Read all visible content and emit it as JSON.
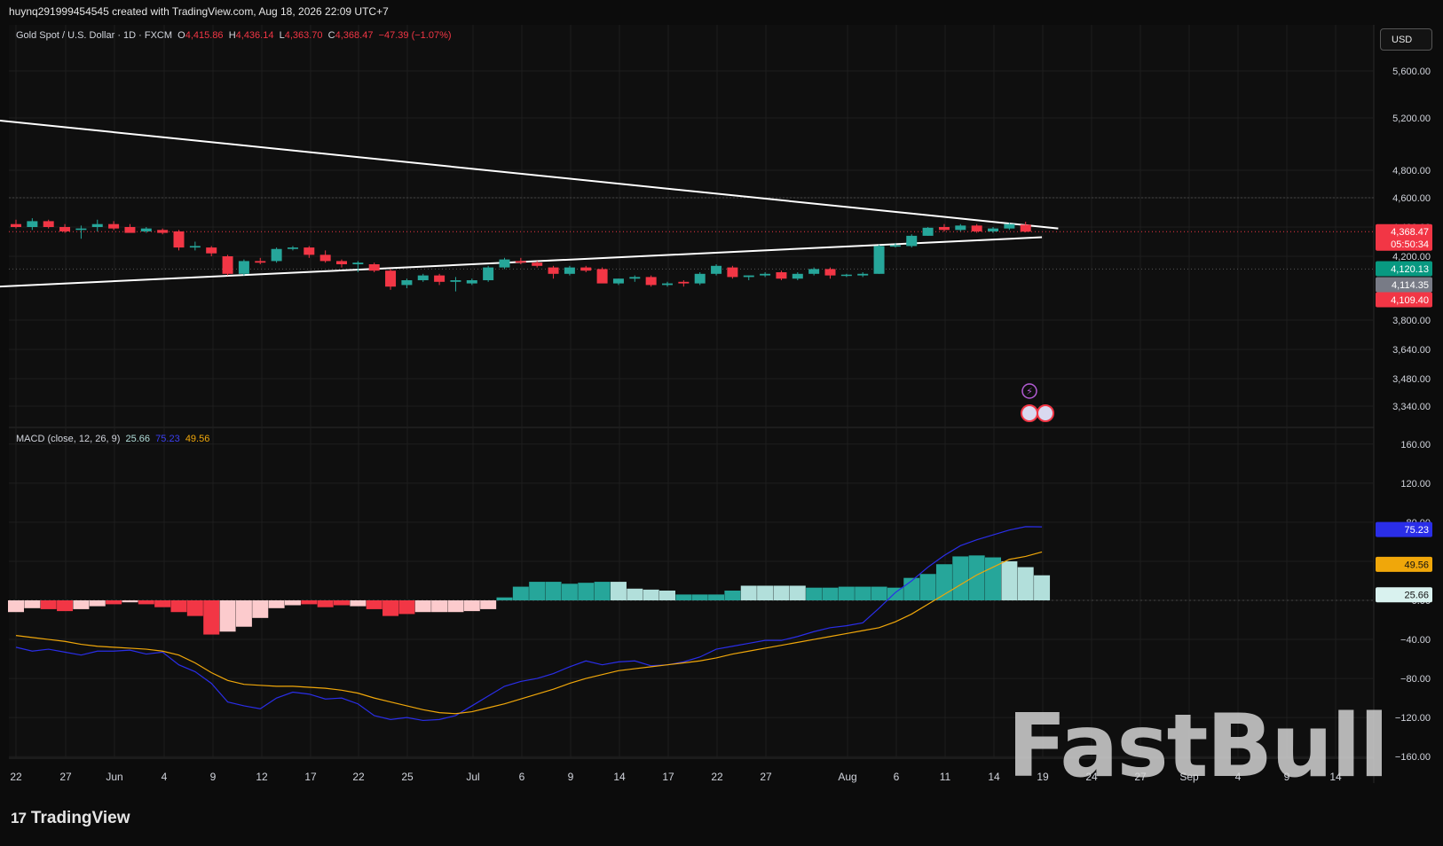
{
  "header": {
    "attribution": "huynq291999454545 created with TradingView.com, Aug 18, 2026 22:09 UTC+7"
  },
  "legend": {
    "symbol": "Gold Spot / U.S. Dollar · 1D · FXCM",
    "o_label": "O",
    "o": "4,415.86",
    "h_label": "H",
    "h": "4,436.14",
    "l_label": "L",
    "l": "4,363.70",
    "c_label": "C",
    "c": "4,368.47",
    "change": "−47.39 (−1.07%)"
  },
  "currency_button": "USD",
  "macd_legend": {
    "label": "MACD (close, 12, 26, 9)",
    "hist": "25.66",
    "macd": "75.23",
    "signal": "49.56"
  },
  "colors": {
    "up": "#26a69a",
    "down": "#f23645",
    "macd_line": "#2a2ee8",
    "signal_line": "#f0a70a",
    "hist_up_strong": "#26a69a",
    "hist_up_weak": "#b2dfdb",
    "hist_down_strong": "#f23645",
    "hist_down_weak": "#fccbcd"
  },
  "footer": {
    "logo_mark": "17",
    "logo_text": "TradingView"
  },
  "watermark": "FastBull",
  "price_labels": [
    {
      "text": "4,368.47",
      "sub": "05:50:34",
      "value": 4368.47,
      "color": "#f23645"
    },
    {
      "text": "4,120.13",
      "value": 4120.13,
      "color": "#089981"
    },
    {
      "text": "4,114.35",
      "value": 4114.35,
      "color": "#787b86"
    },
    {
      "text": "4,109.40",
      "value": 4109.4,
      "color": "#f23645"
    }
  ],
  "macd_labels": [
    {
      "text": "75.23",
      "value": 75.23,
      "color": "#2a2ee8"
    },
    {
      "text": "49.56",
      "value": 49.56,
      "color": "#f0a70a"
    },
    {
      "text": "25.66",
      "value": 25.66,
      "color": "#b2dfdb"
    }
  ],
  "chart_data": [
    {
      "type": "candlestick",
      "title": "Gold Spot / U.S. Dollar · 1D · FXCM",
      "y_ticks": [
        5600,
        5200,
        4800,
        4600,
        4400,
        4200,
        3800,
        3640,
        3480,
        3340
      ],
      "y_tick_labels": [
        "5,600.00",
        "5,200.00",
        "4,800.00",
        "4,600.00",
        "4,400.00",
        "4,200.00",
        "3,800.00",
        "3,640.00",
        "3,480.00",
        "3,340.00"
      ],
      "x_ticks": [
        "22",
        "27",
        "Jun",
        "4",
        "9",
        "12",
        "17",
        "22",
        "25",
        "Jul",
        "6",
        "9",
        "14",
        "17",
        "22",
        "27",
        "Aug",
        "6",
        "11",
        "14",
        "19",
        "24",
        "27",
        "Sep",
        "4",
        "9",
        "14"
      ],
      "candles": [
        {
          "o": 4420,
          "h": 4450,
          "l": 4390,
          "c": 4400
        },
        {
          "o": 4400,
          "h": 4460,
          "l": 4380,
          "c": 4440
        },
        {
          "o": 4440,
          "h": 4450,
          "l": 4390,
          "c": 4400
        },
        {
          "o": 4400,
          "h": 4420,
          "l": 4360,
          "c": 4370
        },
        {
          "o": 4380,
          "h": 4410,
          "l": 4320,
          "c": 4390
        },
        {
          "o": 4400,
          "h": 4450,
          "l": 4370,
          "c": 4420
        },
        {
          "o": 4420,
          "h": 4440,
          "l": 4380,
          "c": 4390
        },
        {
          "o": 4400,
          "h": 4420,
          "l": 4370,
          "c": 4360
        },
        {
          "o": 4370,
          "h": 4400,
          "l": 4360,
          "c": 4390
        },
        {
          "o": 4380,
          "h": 4390,
          "l": 4350,
          "c": 4360
        },
        {
          "o": 4370,
          "h": 4380,
          "l": 4240,
          "c": 4260
        },
        {
          "o": 4260,
          "h": 4300,
          "l": 4240,
          "c": 4270
        },
        {
          "o": 4260,
          "h": 4270,
          "l": 4200,
          "c": 4220
        },
        {
          "o": 4200,
          "h": 4210,
          "l": 4080,
          "c": 4090
        },
        {
          "o": 4090,
          "h": 4180,
          "l": 4080,
          "c": 4170
        },
        {
          "o": 4170,
          "h": 4190,
          "l": 4150,
          "c": 4160
        },
        {
          "o": 4170,
          "h": 4260,
          "l": 4160,
          "c": 4250
        },
        {
          "o": 4250,
          "h": 4270,
          "l": 4240,
          "c": 4260
        },
        {
          "o": 4260,
          "h": 4270,
          "l": 4190,
          "c": 4210
        },
        {
          "o": 4210,
          "h": 4240,
          "l": 4160,
          "c": 4170
        },
        {
          "o": 4170,
          "h": 4180,
          "l": 4130,
          "c": 4150
        },
        {
          "o": 4150,
          "h": 4170,
          "l": 4100,
          "c": 4160
        },
        {
          "o": 4150,
          "h": 4160,
          "l": 4100,
          "c": 4110
        },
        {
          "o": 4110,
          "h": 4120,
          "l": 3990,
          "c": 4010
        },
        {
          "o": 4020,
          "h": 4060,
          "l": 4000,
          "c": 4050
        },
        {
          "o": 4050,
          "h": 4090,
          "l": 4040,
          "c": 4080
        },
        {
          "o": 4080,
          "h": 4090,
          "l": 4020,
          "c": 4040
        },
        {
          "o": 4040,
          "h": 4070,
          "l": 3980,
          "c": 4050
        },
        {
          "o": 4030,
          "h": 4060,
          "l": 4020,
          "c": 4050
        },
        {
          "o": 4050,
          "h": 4140,
          "l": 4040,
          "c": 4130
        },
        {
          "o": 4130,
          "h": 4190,
          "l": 4120,
          "c": 4180
        },
        {
          "o": 4170,
          "h": 4190,
          "l": 4150,
          "c": 4160
        },
        {
          "o": 4160,
          "h": 4170,
          "l": 4130,
          "c": 4140
        },
        {
          "o": 4130,
          "h": 4140,
          "l": 4060,
          "c": 4090
        },
        {
          "o": 4090,
          "h": 4140,
          "l": 4080,
          "c": 4130
        },
        {
          "o": 4130,
          "h": 4140,
          "l": 4100,
          "c": 4110
        },
        {
          "o": 4120,
          "h": 4130,
          "l": 4040,
          "c": 4030
        },
        {
          "o": 4030,
          "h": 4060,
          "l": 4020,
          "c": 4060
        },
        {
          "o": 4060,
          "h": 4080,
          "l": 4040,
          "c": 4070
        },
        {
          "o": 4070,
          "h": 4080,
          "l": 4010,
          "c": 4020
        },
        {
          "o": 4020,
          "h": 4040,
          "l": 4010,
          "c": 4030
        },
        {
          "o": 4040,
          "h": 4050,
          "l": 4010,
          "c": 4030
        },
        {
          "o": 4030,
          "h": 4100,
          "l": 4020,
          "c": 4090
        },
        {
          "o": 4090,
          "h": 4150,
          "l": 4080,
          "c": 4140
        },
        {
          "o": 4130,
          "h": 4140,
          "l": 4060,
          "c": 4070
        },
        {
          "o": 4070,
          "h": 4080,
          "l": 4050,
          "c": 4080
        },
        {
          "o": 4080,
          "h": 4100,
          "l": 4070,
          "c": 4090
        },
        {
          "o": 4100,
          "h": 4110,
          "l": 4050,
          "c": 4060
        },
        {
          "o": 4060,
          "h": 4100,
          "l": 4050,
          "c": 4090
        },
        {
          "o": 4090,
          "h": 4130,
          "l": 4080,
          "c": 4120
        },
        {
          "o": 4120,
          "h": 4130,
          "l": 4060,
          "c": 4080
        },
        {
          "o": 4080,
          "h": 4090,
          "l": 4070,
          "c": 4085
        },
        {
          "o": 4080,
          "h": 4100,
          "l": 4070,
          "c": 4090
        },
        {
          "o": 4090,
          "h": 4280,
          "l": 4090,
          "c": 4270
        },
        {
          "o": 4270,
          "h": 4290,
          "l": 4260,
          "c": 4275
        },
        {
          "o": 4270,
          "h": 4350,
          "l": 4260,
          "c": 4340
        },
        {
          "o": 4340,
          "h": 4400,
          "l": 4340,
          "c": 4395
        },
        {
          "o": 4400,
          "h": 4420,
          "l": 4370,
          "c": 4380
        },
        {
          "o": 4380,
          "h": 4420,
          "l": 4370,
          "c": 4410
        },
        {
          "o": 4410,
          "h": 4420,
          "l": 4360,
          "c": 4370
        },
        {
          "o": 4370,
          "h": 4400,
          "l": 4360,
          "c": 4390
        },
        {
          "o": 4390,
          "h": 4430,
          "l": 4380,
          "c": 4420
        },
        {
          "o": 4415.86,
          "h": 4436.14,
          "l": 4363.7,
          "c": 4368.47
        }
      ],
      "trendlines": [
        {
          "from": {
            "bar": -1,
            "price": 5180
          },
          "to": {
            "bar": 64,
            "price": 4390
          }
        },
        {
          "from": {
            "bar": -1,
            "price": 4010
          },
          "to": {
            "bar": 63,
            "price": 4330
          }
        }
      ]
    },
    {
      "type": "macd",
      "title": "MACD (close, 12, 26, 9)",
      "y_ticks": [
        160,
        120,
        80,
        40,
        0,
        -40,
        -80,
        -120,
        -160
      ],
      "y_tick_labels": [
        "160.00",
        "120.00",
        "80.00",
        "40.00",
        "0.00",
        "−40.00",
        "−80.00",
        "−120.00",
        "−160.00"
      ],
      "histogram": [
        -12,
        -8,
        -9,
        -11,
        -9,
        -6,
        -4,
        -2,
        -4,
        -7,
        -12,
        -16,
        -35,
        -32,
        -27,
        -18,
        -8,
        -5,
        -4,
        -7,
        -5,
        -6,
        -9,
        -16,
        -14,
        -12,
        -12,
        -12,
        -11,
        -9,
        3,
        14,
        19,
        19,
        17,
        18,
        19,
        19,
        12,
        11,
        10,
        6,
        6,
        6,
        10,
        15,
        15,
        15,
        15,
        13,
        13,
        14,
        14,
        14,
        13,
        23,
        27,
        37,
        45,
        46,
        44,
        40,
        34,
        25.66
      ],
      "hist_colors": [
        "w",
        "w",
        "s",
        "s",
        "w",
        "w",
        "s",
        "w",
        "s",
        "s",
        "s",
        "s",
        "s",
        "w",
        "w",
        "w",
        "w",
        "w",
        "s",
        "s",
        "s",
        "w",
        "s",
        "s",
        "s",
        "w",
        "w",
        "w",
        "w",
        "w",
        "s",
        "s",
        "s",
        "s",
        "s",
        "s",
        "s",
        "w",
        "w",
        "w",
        "w",
        "s",
        "s",
        "s",
        "s",
        "w",
        "w",
        "w",
        "w",
        "s",
        "s",
        "s",
        "s",
        "s",
        "s",
        "s",
        "s",
        "s",
        "s",
        "s",
        "s",
        "w",
        "w",
        "w"
      ],
      "macd": [
        -48,
        -52,
        -50,
        -53,
        -56,
        -52,
        -52,
        -51,
        -55,
        -53,
        -66,
        -73,
        -85,
        -104,
        -108,
        -111,
        -100,
        -94,
        -96,
        -101,
        -100,
        -106,
        -118,
        -122,
        -120,
        -123,
        -122,
        -118,
        -108,
        -98,
        -88,
        -83,
        -80,
        -75,
        -68,
        -62,
        -66,
        -63,
        -62,
        -67,
        -66,
        -63,
        -58,
        -50,
        -47,
        -44,
        -41,
        -41,
        -37,
        -32,
        -28,
        -26,
        -23,
        -8,
        8,
        20,
        34,
        46,
        56,
        62,
        67,
        72,
        75.5,
        75.23
      ],
      "signal": [
        -36,
        -38,
        -40,
        -42,
        -45,
        -47,
        -48,
        -49,
        -50,
        -52,
        -56,
        -64,
        -74,
        -82,
        -86,
        -87,
        -88,
        -88,
        -89,
        -90,
        -92,
        -95,
        -100,
        -104,
        -108,
        -112,
        -115,
        -116,
        -114,
        -110,
        -106,
        -101,
        -96,
        -91,
        -85,
        -80,
        -76,
        -72,
        -70,
        -68,
        -66,
        -64,
        -62,
        -59,
        -55,
        -52,
        -49,
        -46,
        -43,
        -40,
        -37,
        -34,
        -31,
        -28,
        -22,
        -14,
        -4,
        6,
        16,
        26,
        34,
        42,
        45,
        49.56
      ]
    }
  ]
}
